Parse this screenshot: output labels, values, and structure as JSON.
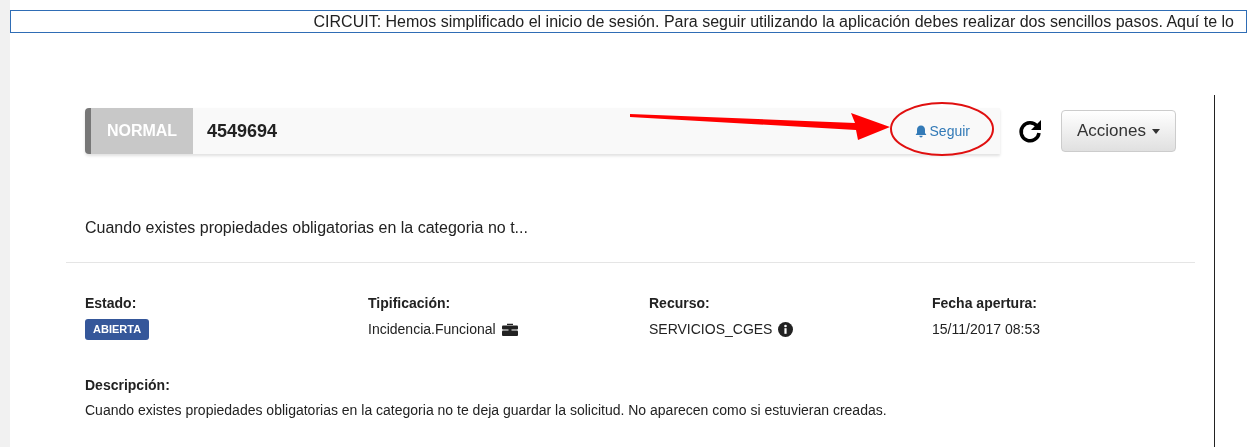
{
  "banner": {
    "text": "CIRCUIT: Hemos simplificado el inicio de sesión. Para seguir utilizando la aplicación debes realizar dos sencillos pasos. Aquí te lo"
  },
  "ticket": {
    "priority": "NORMAL",
    "number": "4549694",
    "follow": {
      "label": "Seguir"
    },
    "actions": {
      "label": "Acciones"
    }
  },
  "title": "Cuando existes propiedades obligatorias en la categoria no t...",
  "fields": [
    {
      "label": "Estado:",
      "value": "ABIERTA",
      "kind": "badge"
    },
    {
      "label": "Tipificación:",
      "value": "Incidencia.Funcional",
      "kind": "briefcase"
    },
    {
      "label": "Recurso:",
      "value": "SERVICIOS_CGES",
      "kind": "info"
    },
    {
      "label": "Fecha apertura:",
      "value": "15/11/2017 08:53",
      "kind": "text"
    }
  ],
  "description": {
    "label": "Descripción:",
    "text": "Cuando existes propiedades obligatorias en la categoria no te deja guardar la solicitud. No aparecen como si estuvieran creadas."
  }
}
